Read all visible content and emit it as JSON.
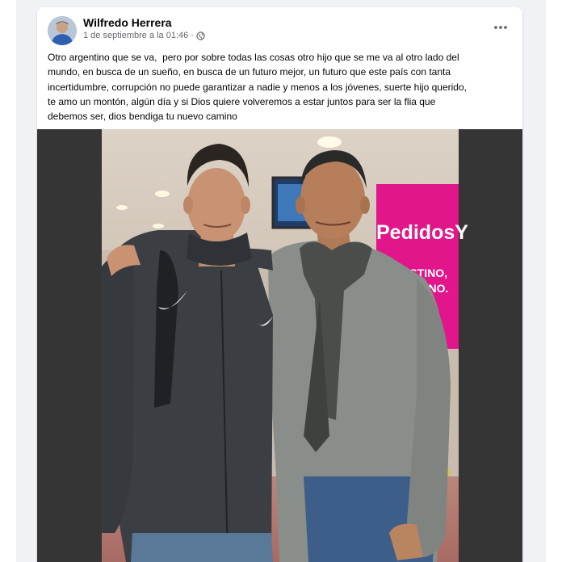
{
  "post": {
    "author": "Wilfredo Herrera",
    "timestamp": "1 de septiembre a la 01:46",
    "separator": "·",
    "visibility_icon": "globe-icon",
    "more_icon": "more-options-icon",
    "text": "Otro argentino que se va,  pero por sobre todas las cosas otro hijo que se me va al otro lado del\nmundo, en busca de un sueño, en busca de un futuro mejor, un futuro que este país con tanta\nincertidumbre, corrupción no puede garantizar a nadie y menos a los jóvenes, suerte hijo querido,\nte amo un montón, algún día y si Dios quiere volveremos a estar juntos para ser la flia que\ndebemos ser, dios bendiga tu nuevo camino"
  },
  "photo": {
    "sign_brand": "PedidosY",
    "sign_line1": "ESTINO,",
    "sign_line2": "NTINO."
  },
  "colors": {
    "feed_background": "#f0f2f5",
    "card_background": "#ffffff",
    "text_primary": "#050505",
    "text_secondary": "#65676b",
    "sign_magenta": "#e0168a"
  }
}
